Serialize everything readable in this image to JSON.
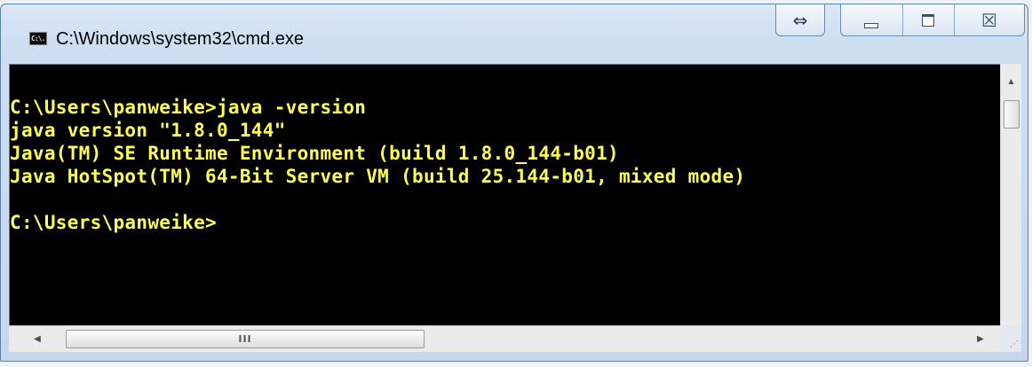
{
  "window": {
    "title": "C:\\Windows\\system32\\cmd.exe",
    "icon": "cmd-icon",
    "icon_text": "C:\\."
  },
  "controls": {
    "extra_glyph": "⇔",
    "minimize": "minimize-icon",
    "maximize": "maximize-icon",
    "close_glyph": "☒"
  },
  "terminal": {
    "text_color": "#ffff54",
    "background": "#000000",
    "lines": [
      "C:\\Users\\panweike>java -version",
      "java version \"1.8.0_144\"",
      "Java(TM) SE Runtime Environment (build 1.8.0_144-b01)",
      "Java HotSpot(TM) 64-Bit Server VM (build 25.144-b01, mixed mode)",
      "",
      "C:\\Users\\panweike>"
    ]
  },
  "scrollbars": {
    "up_arrow": "▲",
    "down_arrow": "▼",
    "left_arrow": "◀",
    "right_arrow": "▶",
    "h_thumb_grip": "III",
    "size_grip": "⋰"
  }
}
